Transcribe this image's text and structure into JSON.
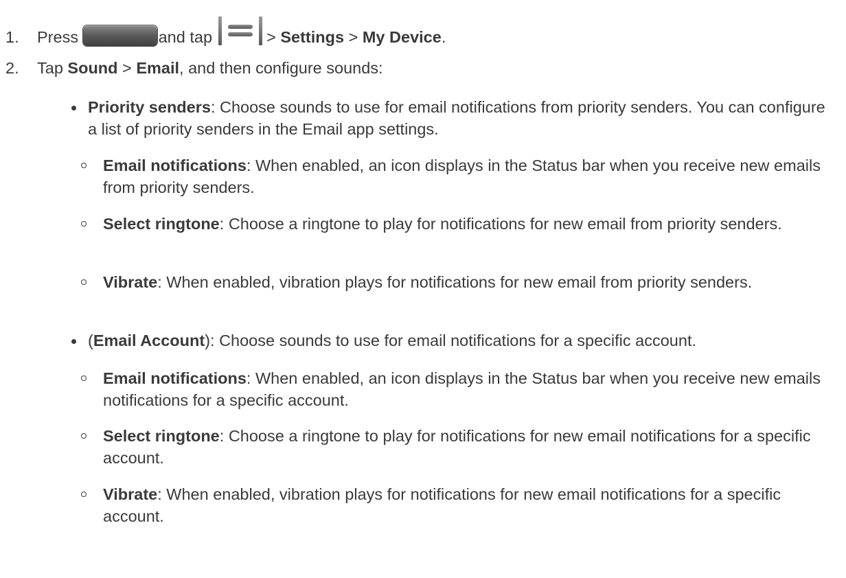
{
  "steps": [
    {
      "num": "1.",
      "press": "Press",
      "and_tap": "and tap",
      "sep1": ">",
      "settings": "Settings",
      "sep2": ">",
      "my_device": "My Device",
      "end": "."
    },
    {
      "num": "2.",
      "tap": "Tap",
      "sound": "Sound",
      "sep": ">",
      "email": "Email",
      "rest": ", and then configure sounds:"
    }
  ],
  "icons": {
    "home": "home-key-icon",
    "menu": "menu-key-icon"
  },
  "options": [
    {
      "term": "Priority senders",
      "desc": ": Choose sounds to use for email notifications from priority senders. You can configure a list of priority senders in the Email app settings.",
      "subs": [
        {
          "term": "Email notifications",
          "desc": ": When enabled, an icon displays in the Status bar when you receive new emails from priority senders."
        },
        {
          "term": "Select ringtone",
          "desc": ": Choose a ringtone to play for notifications for new email from priority senders."
        },
        {
          "term": "Vibrate",
          "desc": ": When enabled, vibration plays for notifications for new email from priority senders."
        }
      ]
    },
    {
      "prefix": "(",
      "term": "Email Account",
      "desc": "): Choose sounds to use for email notifications for a specific account.",
      "subs": [
        {
          "term": "Email notifications",
          "desc": ": When enabled, an icon displays in the Status bar when you receive new emails notifications for a specific account."
        },
        {
          "term": "Select ringtone",
          "desc": ": Choose a ringtone to play for notifications for new email notifications for a specific account."
        },
        {
          "term": "Vibrate",
          "desc": ": When enabled, vibration plays for notifications for new email notifications for a specific account."
        }
      ]
    }
  ]
}
